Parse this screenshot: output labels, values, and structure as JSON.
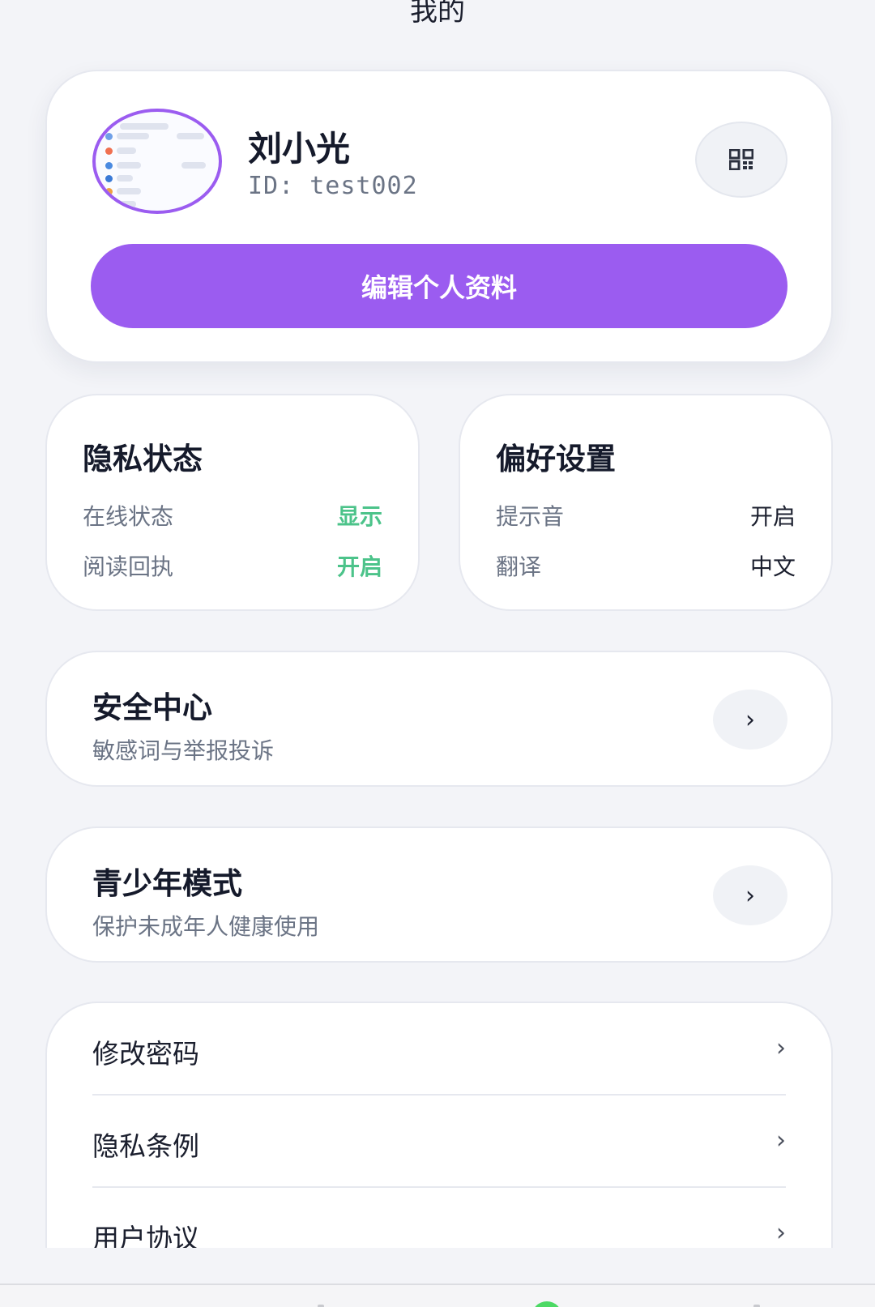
{
  "header": {
    "title": "我的"
  },
  "profile": {
    "name": "刘小光",
    "id_text": "ID: test002",
    "edit_label": "编辑个人资料"
  },
  "privacy": {
    "title": "隐私状态",
    "items": [
      {
        "label": "在线状态",
        "value": "显示"
      },
      {
        "label": "阅读回执",
        "value": "开启"
      }
    ]
  },
  "preferences": {
    "title": "偏好设置",
    "items": [
      {
        "label": "提示音",
        "value": "开启"
      },
      {
        "label": "翻译",
        "value": "中文"
      }
    ]
  },
  "security": {
    "title": "安全中心",
    "subtitle": "敏感词与举报投诉"
  },
  "teen_mode": {
    "title": "青少年模式",
    "subtitle": "保护未成年人健康使用"
  },
  "menu": {
    "items": [
      {
        "label": "修改密码"
      },
      {
        "label": "隐私条例"
      },
      {
        "label": "用户协议"
      }
    ]
  },
  "colors": {
    "accent": "#9b5cf0",
    "success": "#4cc38a",
    "background": "#f3f4f8"
  }
}
